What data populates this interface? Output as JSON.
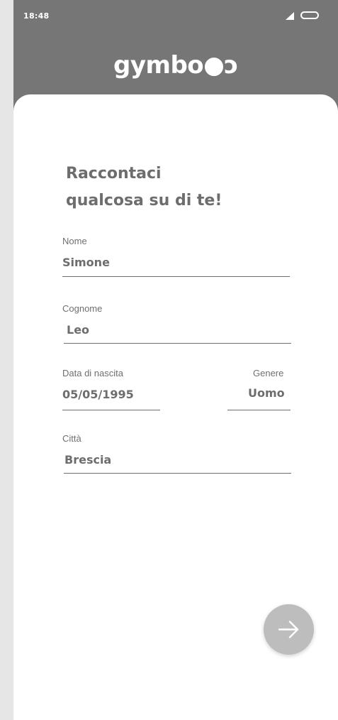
{
  "status_bar": {
    "time": "18:48",
    "signal_icon": "signal-icon",
    "battery_icon": "battery-icon"
  },
  "header": {
    "logo_text": "gymbo●ɔ"
  },
  "form": {
    "heading_line1": "Raccontaci",
    "heading_line2": "qualcosa su di te!",
    "nome": {
      "label": "Nome",
      "value": "Simone"
    },
    "cognome": {
      "label": "Cognome",
      "value": "Leo"
    },
    "data_nascita": {
      "label": "Data di nascita",
      "value": "05/05/1995"
    },
    "genere": {
      "label": "Genere",
      "value": "Uomo"
    },
    "citta": {
      "label": "Città",
      "value": "Brescia"
    }
  },
  "next_button": {
    "icon": "arrow-right-icon"
  },
  "colors": {
    "header_bg": "#767676",
    "card_bg": "#ffffff",
    "text": "#6d6d6d",
    "button_bg": "#bdbdbd"
  }
}
